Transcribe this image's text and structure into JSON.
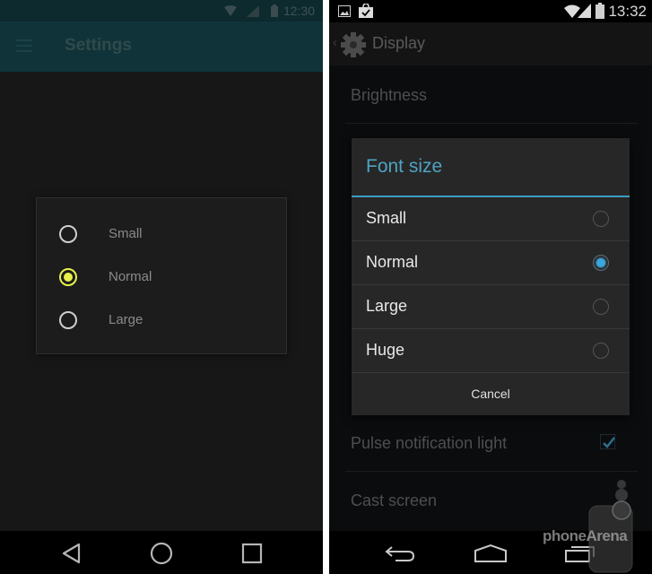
{
  "left_screen": {
    "status_bar": {
      "time": "12:30",
      "icons": [
        "wifi-icon",
        "signal-icon",
        "battery-icon"
      ]
    },
    "app_bar": {
      "menu_icon": "hamburger-menu-icon",
      "title": "Settings"
    },
    "dialog": {
      "options": [
        {
          "label": "Small",
          "selected": false
        },
        {
          "label": "Normal",
          "selected": true
        },
        {
          "label": "Large",
          "selected": false
        }
      ],
      "accent_color": "#e8f04a"
    },
    "nav_bar": {
      "buttons": [
        "back-triangle-icon",
        "home-circle-icon",
        "recents-square-icon"
      ]
    }
  },
  "right_screen": {
    "status_bar": {
      "time": "13:32",
      "left_icons": [
        "gallery-icon",
        "play-store-update-icon"
      ],
      "right_icons": [
        "wifi-icon",
        "signal-icon",
        "battery-icon"
      ]
    },
    "action_bar": {
      "back_icon": "caret-left-icon",
      "app_icon": "gear-icon",
      "title": "Display"
    },
    "settings_list": [
      {
        "label": "Brightness"
      },
      {
        "label": "Pulse notification light",
        "checkbox": true,
        "checked": true
      },
      {
        "label": "Cast screen"
      }
    ],
    "dialog": {
      "title": "Font size",
      "options": [
        {
          "label": "Small",
          "selected": false
        },
        {
          "label": "Normal",
          "selected": true
        },
        {
          "label": "Large",
          "selected": false
        },
        {
          "label": "Huge",
          "selected": false
        }
      ],
      "cancel_label": "Cancel",
      "accent_color": "#3b9dc2"
    },
    "nav_bar": {
      "buttons": [
        "back-arrow-icon",
        "home-icon",
        "recent-apps-icon"
      ]
    },
    "watermark": {
      "part1": "phone",
      "part2": "Arena"
    }
  }
}
